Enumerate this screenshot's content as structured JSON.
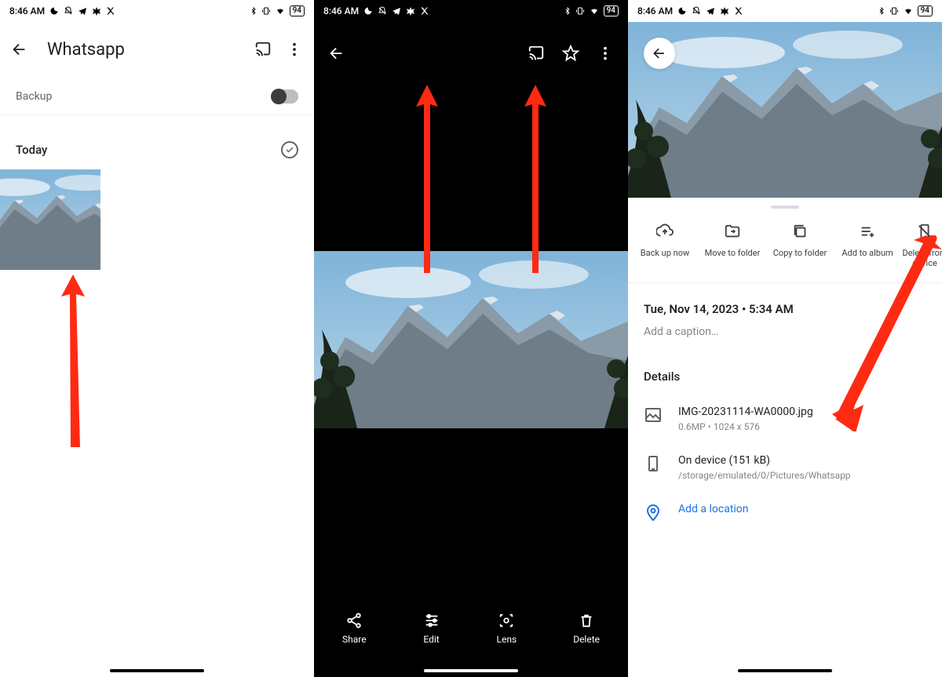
{
  "status": {
    "time": "8:46 AM",
    "left_icons": [
      "moon-icon",
      "dnd-icon",
      "telegram-icon",
      "pinwheel-icon",
      "x-icon"
    ],
    "right_icons": [
      "bluetooth-icon",
      "vibrate-icon",
      "wifi-icon"
    ],
    "battery": "94"
  },
  "pane1": {
    "title": "Whatsapp",
    "backup_label": "Backup",
    "backup_on": false,
    "section_label": "Today"
  },
  "pane2": {
    "bottom": {
      "share": "Share",
      "edit": "Edit",
      "lens": "Lens",
      "delete": "Delete"
    }
  },
  "pane3": {
    "actions": {
      "backup": "Back up now",
      "move": "Move to folder",
      "copy": "Copy to folder",
      "album": "Add to album",
      "delete": "Delete from device"
    },
    "date": "Tue, Nov 14, 2023",
    "time": "5:34 AM",
    "date_sep": "  •  ",
    "caption_placeholder": "Add a caption…",
    "details_heading": "Details",
    "file": {
      "name": "IMG-20231114-WA0000.jpg",
      "mp": "0.6MP",
      "dims": "1024 x 576",
      "sep": "  •  "
    },
    "storage": {
      "title": "On device (151 kB)",
      "path": "/storage/emulated/0/Pictures/Whatsapp"
    },
    "location_label": "Add a location"
  }
}
